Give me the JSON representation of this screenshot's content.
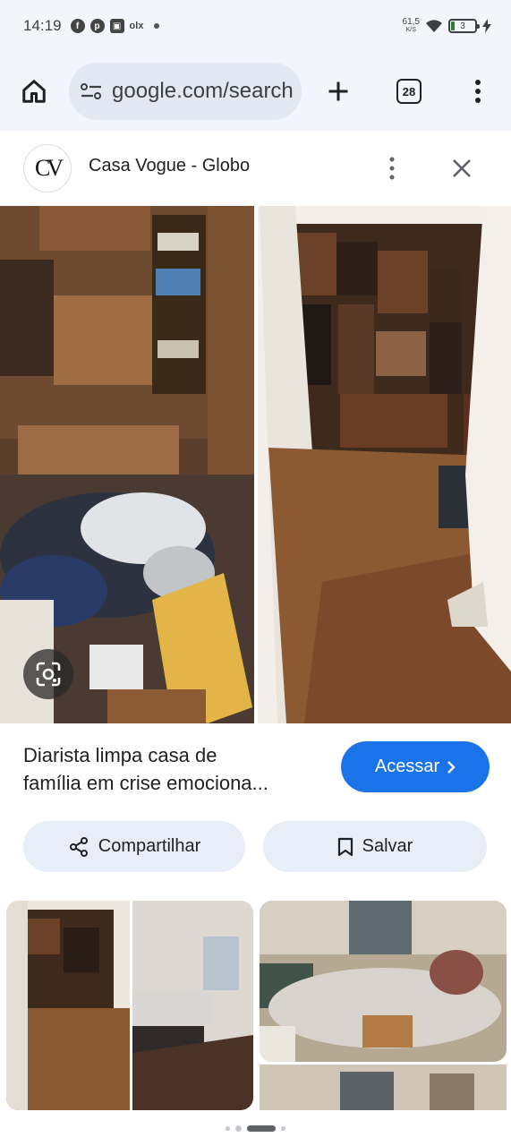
{
  "status_bar": {
    "time": "14:19",
    "network_speed": "61,5",
    "network_unit": "K/S",
    "battery": "3",
    "olx": "olx"
  },
  "toolbar": {
    "url": "google.com/search",
    "tab_count": "28"
  },
  "source": {
    "logo_text": "CV",
    "name": "Casa Vogue - Globo"
  },
  "caption": {
    "line1": "Diarista limpa casa de",
    "line2": "família em crise emociona..."
  },
  "buttons": {
    "access_label": "Acessar",
    "share_label": "Compartilhar",
    "save_label": "Salvar"
  },
  "colors": {
    "accent": "#1a73e8",
    "toolbar_bg": "#f2f5fb",
    "chip_bg": "#e8eef8"
  }
}
